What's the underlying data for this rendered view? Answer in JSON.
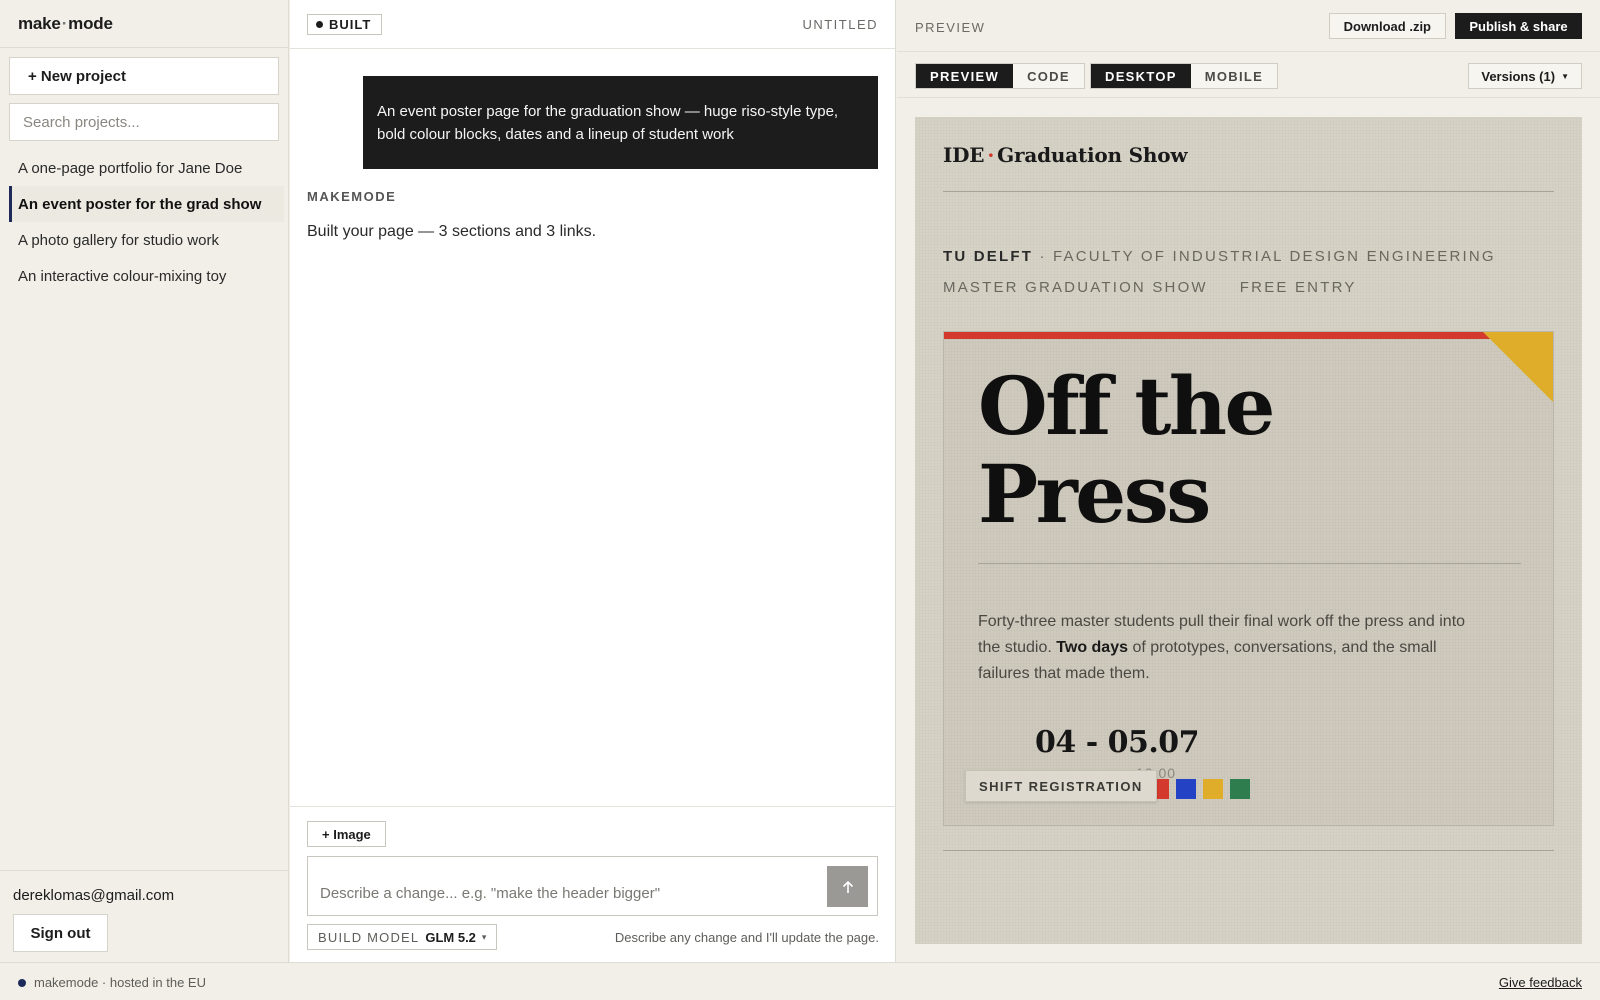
{
  "brand": {
    "name_left": "make",
    "separator": "·",
    "name_right": "mode"
  },
  "sidebar": {
    "new_project_label": "+ New project",
    "search_placeholder": "Search projects...",
    "projects": [
      {
        "label": "A one-page portfolio for Jane Doe",
        "active": false
      },
      {
        "label": "An event poster for the grad show",
        "active": true
      },
      {
        "label": "A photo gallery for studio work",
        "active": false
      },
      {
        "label": "An interactive colour-mixing toy",
        "active": false
      }
    ],
    "account_email": "dereklomas@gmail.com",
    "sign_out_label": "Sign out"
  },
  "chat": {
    "status_badge": "BUILT",
    "doc_title": "UNTITLED",
    "user_message": "An event poster page for the graduation show — huge riso-style type, bold colour blocks, dates and a lineup of student work",
    "assistant_label": "MAKEMODE",
    "assistant_message": "Built your page — 3 sections and 3 links.",
    "add_image_label": "+ Image",
    "prompt_placeholder": "Describe a change... e.g. \"make the header bigger\"",
    "send_icon": "arrow-up-icon",
    "model_label": "BUILD MODEL",
    "model_name": "GLM 5.2",
    "helper_text": "Describe any change and I'll update the page."
  },
  "preview": {
    "title": "PREVIEW",
    "download_label": "Download .zip",
    "publish_label": "Publish & share",
    "view_tabs": [
      {
        "label": "PREVIEW",
        "active": true
      },
      {
        "label": "CODE",
        "active": false
      }
    ],
    "device_tabs": [
      {
        "label": "DESKTOP",
        "active": true
      },
      {
        "label": "MOBILE",
        "active": false
      }
    ],
    "versions_label": "Versions (1)"
  },
  "poster": {
    "masthead_left": "IDE",
    "masthead_dot": "·",
    "masthead_right": "Graduation Show",
    "meta_bold": "TU DELFT",
    "meta_rest": " · FACULTY OF INDUSTRIAL DESIGN ENGINEERING",
    "meta_line2_a": "MASTER GRADUATION SHOW",
    "meta_line2_b": "FREE ENTRY",
    "headline_line1": "Off the",
    "headline_line2": "Press",
    "blurb_part1": "Forty-three master students pull their final work off the press and into the studio. ",
    "blurb_bold": "Two days",
    "blurb_part2": " of prototypes, conversations, and the small failures that made them.",
    "date": "04 - 05.07",
    "date_ghost": "12:00",
    "shift_button": "SHIFT REGISTRATION",
    "colors": {
      "red": "#d4392d",
      "blue": "#2443c4",
      "yellow": "#e0ad2b",
      "green": "#2d7d4e"
    }
  },
  "footer": {
    "status_text": "makemode · hosted in the EU",
    "feedback_label": "Give feedback"
  }
}
